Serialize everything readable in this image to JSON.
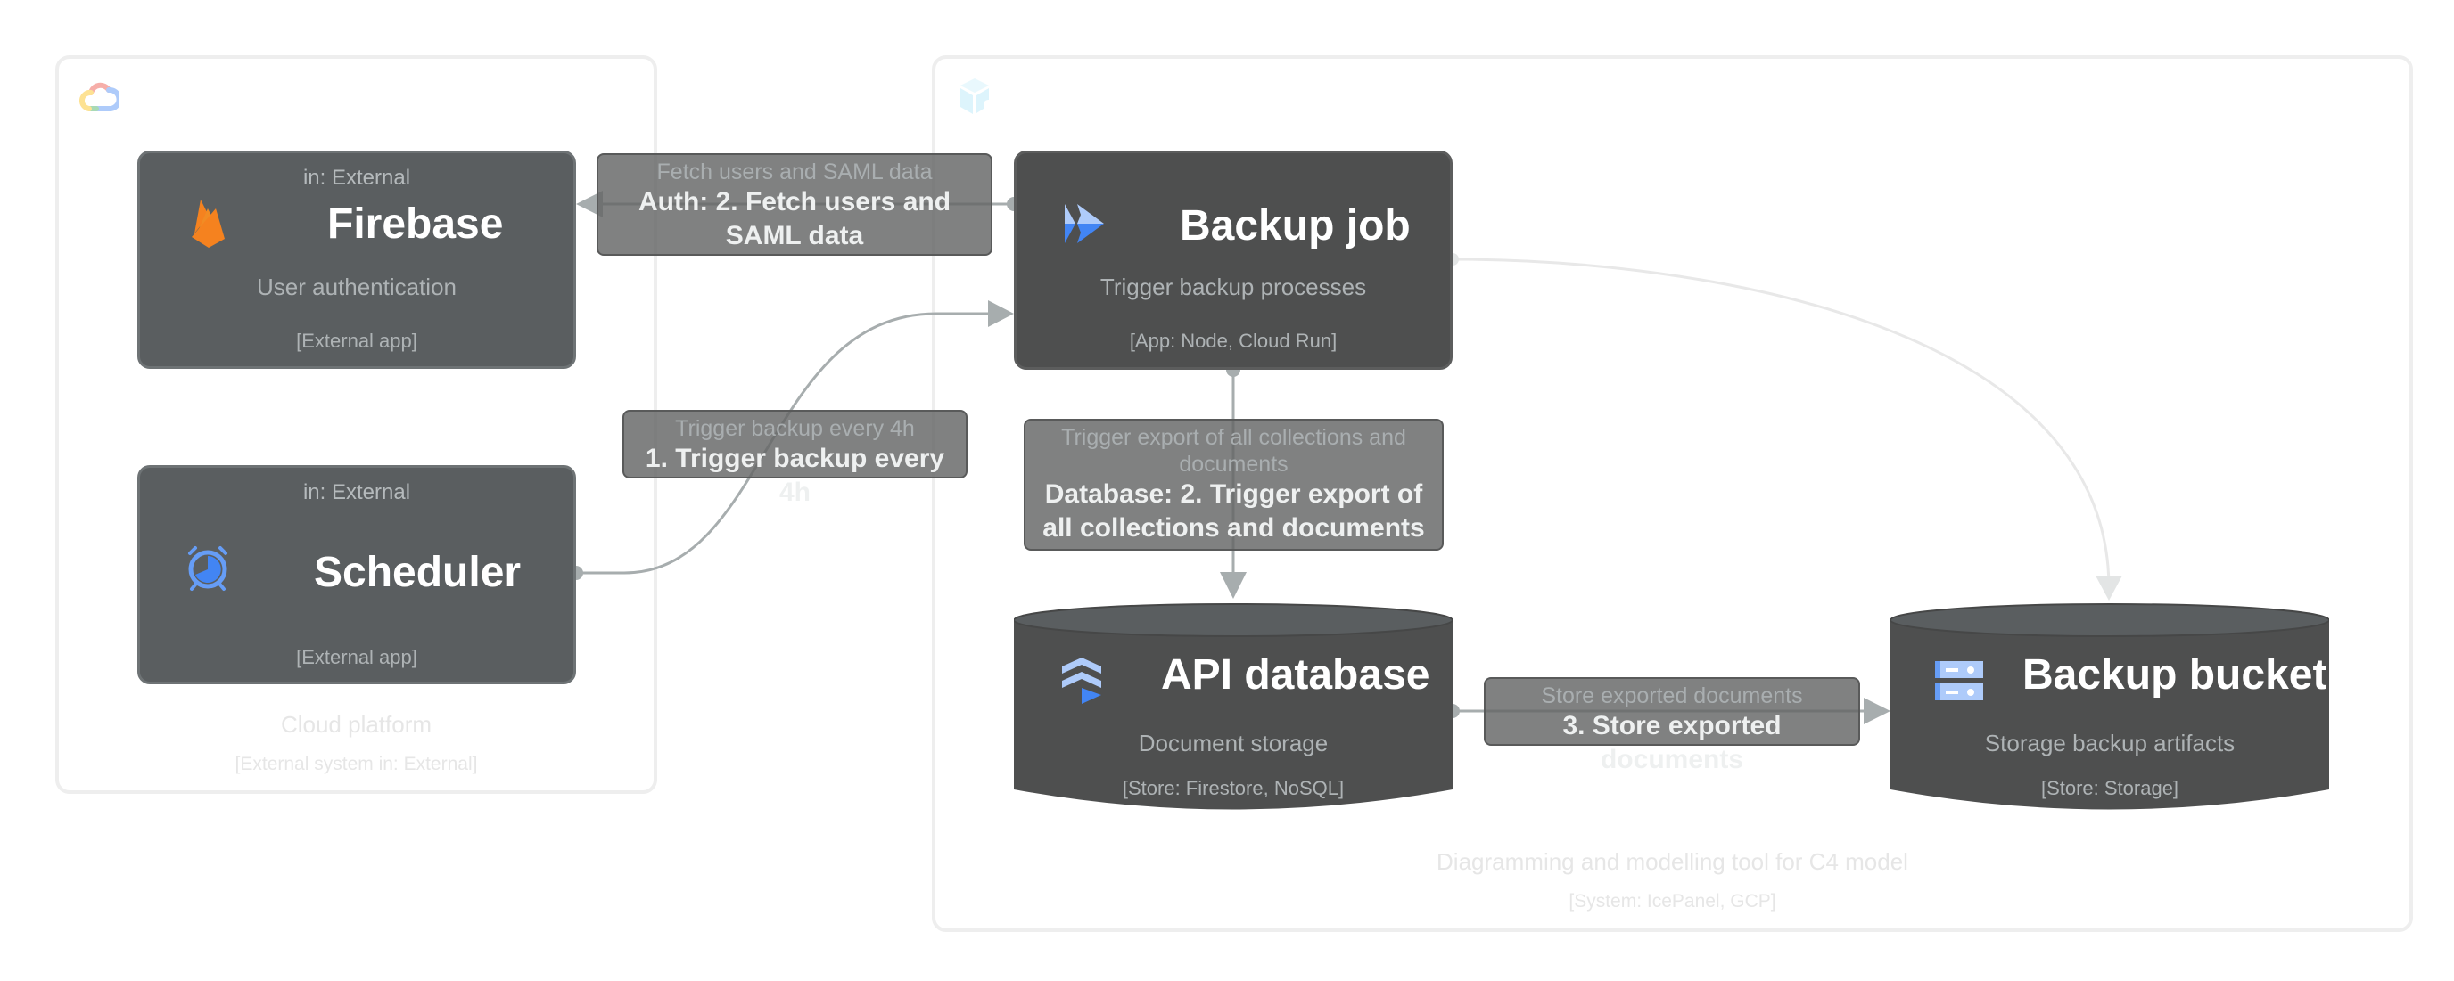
{
  "colors": {
    "external_box": "#5a5e60",
    "app_box": "#4e4f4f",
    "relation_line": "#a7adae",
    "firebase_orange": "#f5821f",
    "gcp_blue": "#4285f4",
    "gcp_light_blue": "#aecbfa"
  },
  "containers": {
    "cloud_platform": {
      "icon": "google-cloud-icon",
      "name": "Cloud platform",
      "type": "[External system in: External]"
    },
    "system": {
      "icon": "icepanel-cube-icon",
      "name": "Diagramming and modelling tool for C4 model",
      "type": "[System: IcePanel, GCP]"
    }
  },
  "nodes": {
    "firebase": {
      "tag": "in: External",
      "icon": "firebase-icon",
      "title": "Firebase",
      "description": "User authentication",
      "technology": "[External app]"
    },
    "scheduler": {
      "tag": "in: External",
      "icon": "cloud-scheduler-icon",
      "title": "Scheduler",
      "description": "",
      "technology": "[External app]"
    },
    "backup_job": {
      "icon": "cloud-run-icon",
      "title": "Backup job",
      "description": "Trigger backup processes",
      "technology": "[App: Node, Cloud Run]"
    },
    "api_database": {
      "icon": "firestore-icon",
      "title": "API database",
      "description": "Document storage",
      "technology": "[Store: Firestore, NoSQL]"
    },
    "backup_bucket": {
      "icon": "cloud-storage-icon",
      "title": "Backup bucket",
      "description": "Storage backup artifacts",
      "technology": "[Store: Storage]"
    }
  },
  "relations": [
    {
      "id": "auth",
      "from": "Backup job",
      "to": "Firebase",
      "description": "Fetch users and SAML data",
      "title": "Auth: 2. Fetch users and SAML data"
    },
    {
      "id": "trigger",
      "from": "Scheduler",
      "to": "Backup job",
      "description": "Trigger backup every 4h",
      "title": "1. Trigger backup every 4h"
    },
    {
      "id": "database",
      "from": "Backup job",
      "to": "API database",
      "description": "Trigger export of all collections and documents",
      "title": "Database: 2. Trigger export of all collections and documents"
    },
    {
      "id": "store",
      "from": "API database",
      "to": "Backup bucket",
      "description": "Store exported documents",
      "title": "3. Store exported documents"
    },
    {
      "id": "job-to-bucket",
      "from": "Backup job",
      "to": "Backup bucket",
      "description": "",
      "title": ""
    }
  ]
}
